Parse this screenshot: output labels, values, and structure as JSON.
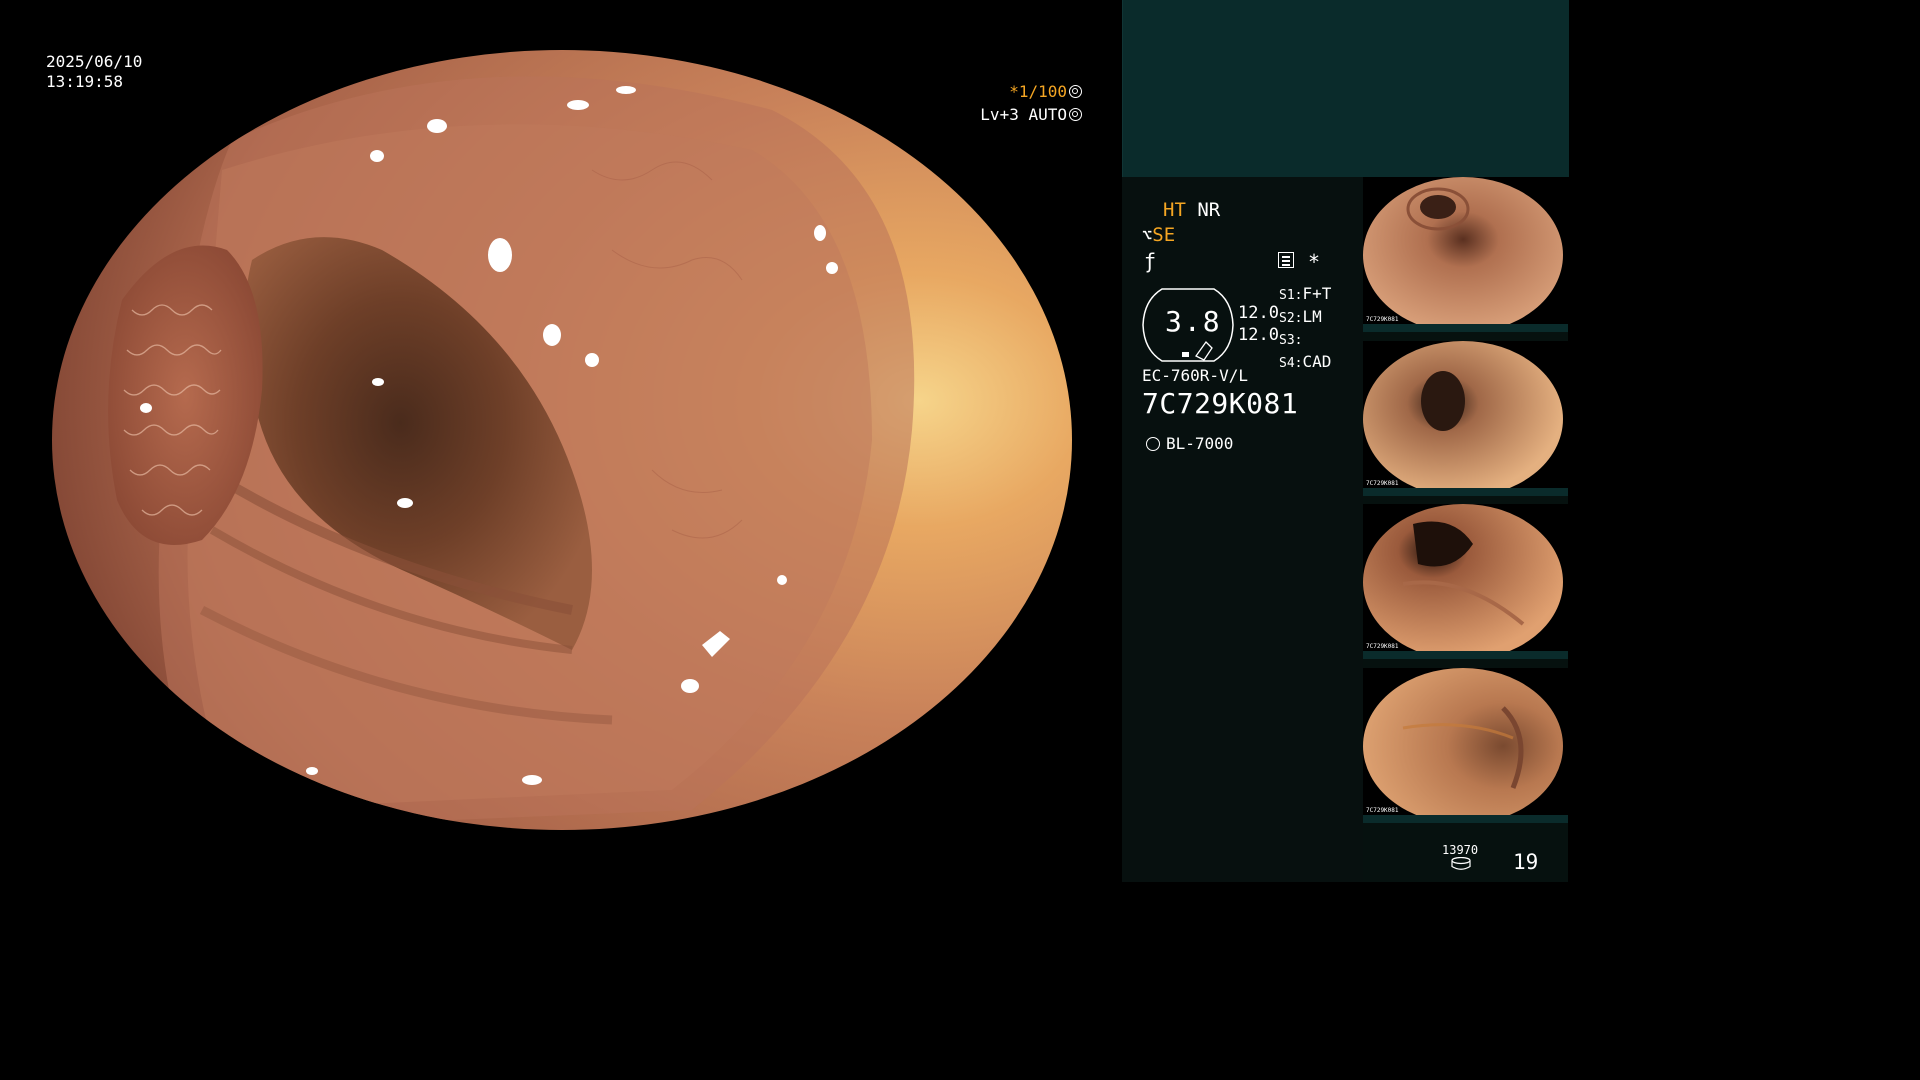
{
  "timestamp": {
    "date": "2025/06/10",
    "time": "13:19:58"
  },
  "exposure": {
    "shutter": "*1/100",
    "level": "Lv+3",
    "mode": "AUTO"
  },
  "side": {
    "ht": "HT",
    "nr": "NR",
    "se": "SE",
    "asterisk": "*",
    "zoom": "3.8",
    "values": [
      "12.0",
      "12.0"
    ],
    "slots": [
      {
        "label": "S1:",
        "value": "F+T"
      },
      {
        "label": "S2:",
        "value": "LM"
      },
      {
        "label": "S3:",
        "value": ""
      },
      {
        "label": "S4:",
        "value": "CAD"
      }
    ],
    "scope_model": "EC-760R-V/L",
    "scope_serial": "7C729K081",
    "light_source": "BL-7000",
    "storage_count": "13970",
    "image_count": "19"
  },
  "thumbnails": [
    {
      "caption": "7C729K081"
    },
    {
      "caption": "7C729K081"
    },
    {
      "caption": "7C729K081"
    },
    {
      "caption": "7C729K081"
    }
  ],
  "colors": {
    "accent_orange": "#f5a623",
    "panel_top": "#0a2b2b",
    "panel_bottom": "#07100f"
  }
}
